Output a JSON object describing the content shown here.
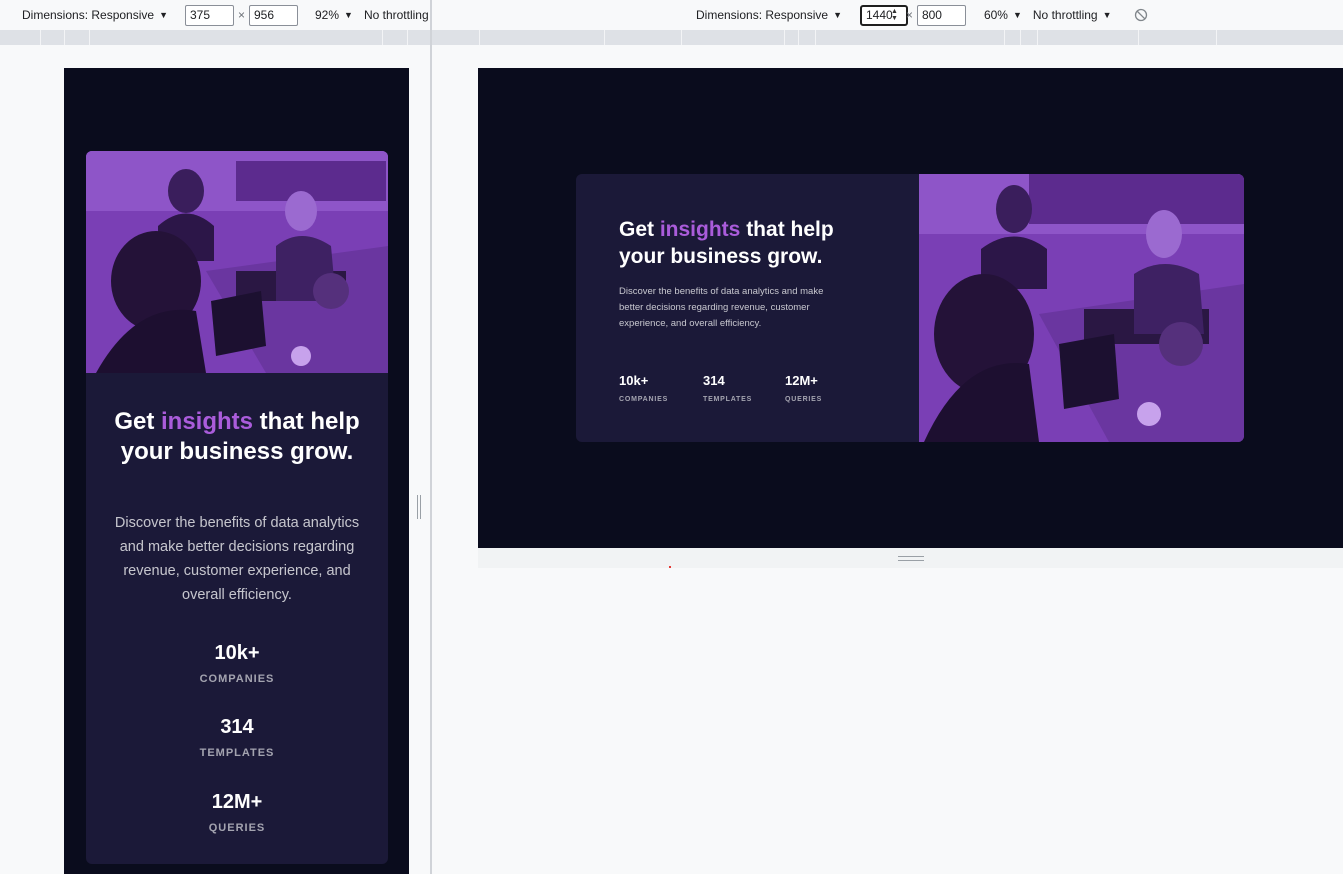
{
  "left_toolbar": {
    "dimensions_label": "Dimensions: Responsive",
    "width": "375",
    "height": "956",
    "zoom": "92%",
    "throttling": "No throttling",
    "times": "×"
  },
  "right_toolbar": {
    "dimensions_label": "Dimensions: Responsive",
    "width": "1440",
    "height": "800",
    "zoom": "60%",
    "throttling": "No throttling",
    "times": "×"
  },
  "card": {
    "headline_before": "Get ",
    "headline_accent": "insights",
    "headline_after": " that help your business grow.",
    "description": "Discover the benefits of data analytics and make better decisions regarding revenue, customer experience, and overall efficiency.",
    "stats": [
      {
        "value": "10k+",
        "label": "COMPANIES"
      },
      {
        "value": "314",
        "label": "TEMPLATES"
      },
      {
        "value": "12M+",
        "label": "QUERIES"
      }
    ]
  },
  "colors": {
    "page_bg": "#0a0c1d",
    "card_bg": "#1b1938",
    "accent": "#aa5cdb",
    "photo_tint": "#7a3fb5"
  },
  "icons": {
    "caret": "caret-down-icon",
    "rotate": "rotate-disabled-icon"
  }
}
